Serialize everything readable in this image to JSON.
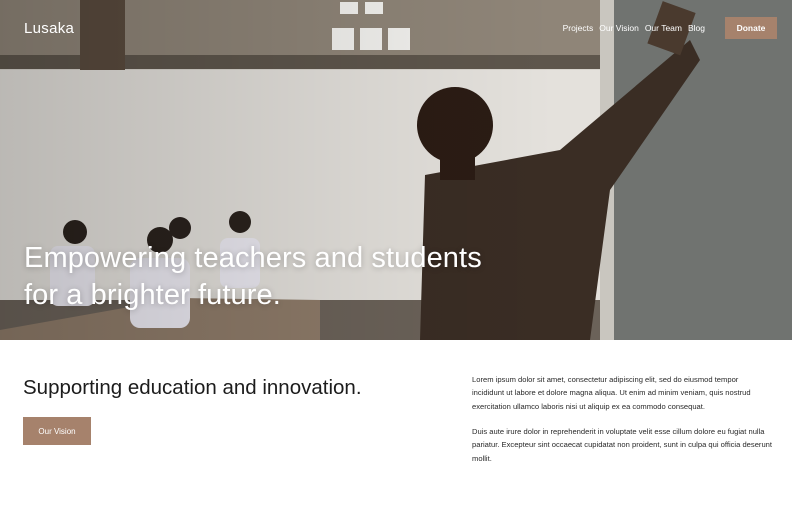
{
  "header": {
    "brand": "Lusaka",
    "nav": [
      "Projects",
      "Our Vision",
      "Our Team",
      "Blog"
    ],
    "donate_label": "Donate"
  },
  "hero": {
    "headline_line1": "Empowering teachers and students",
    "headline_line2": "for a brighter future.",
    "image": "classroom-teacher-at-chalkboard-photo"
  },
  "content": {
    "title": "Supporting education and innovation.",
    "cta_label": "Our Vision",
    "paragraph1": "Lorem ipsum dolor sit amet, consectetur adipiscing elit, sed do eiusmod tempor incididunt ut labore et dolore magna aliqua. Ut enim ad minim veniam, quis nostrud exercitation ullamco laboris nisi ut aliquip ex ea commodo consequat.",
    "paragraph2": "Duis aute irure dolor in reprehenderit in voluptate velit esse cillum dolore eu fugiat nulla pariatur. Excepteur sint occaecat cupidatat non proident, sunt in culpa qui officia deserunt mollit."
  },
  "colors": {
    "accent": "#a6826c",
    "text": "#1c1c1c",
    "white": "#ffffff"
  }
}
